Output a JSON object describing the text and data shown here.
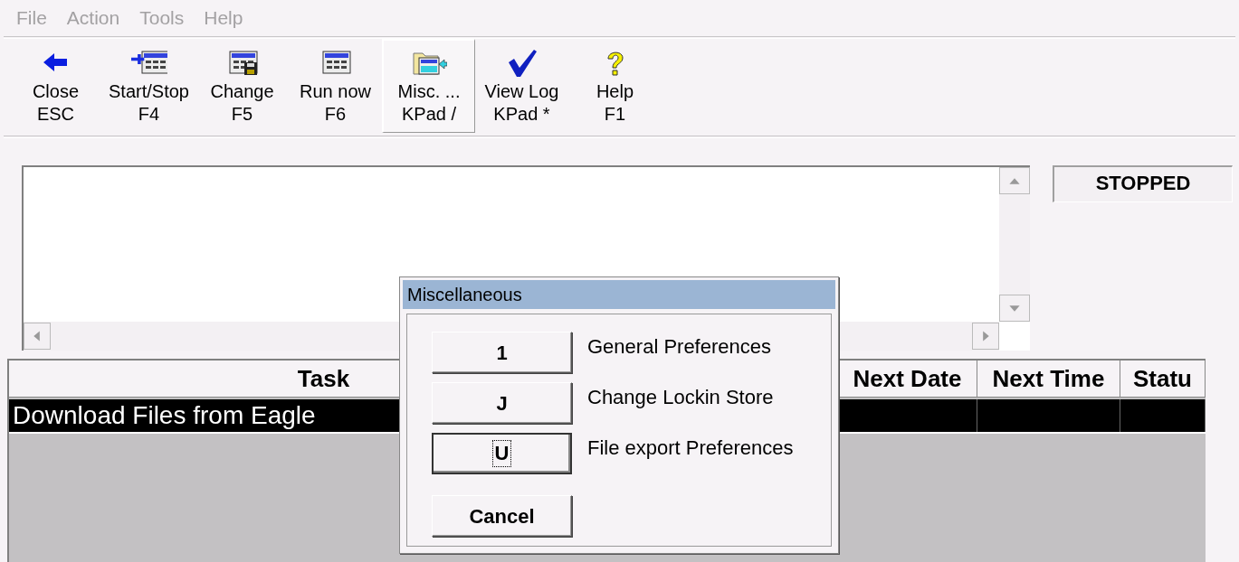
{
  "menu": [
    {
      "label": "File",
      "disabled": true
    },
    {
      "label": "Action",
      "disabled": true
    },
    {
      "label": "Tools",
      "disabled": true
    },
    {
      "label": "Help",
      "disabled": true
    }
  ],
  "toolbar": [
    {
      "kind": "close",
      "label": "Close",
      "key": "ESC",
      "pressed": false
    },
    {
      "kind": "startstop",
      "label": "Start/Stop",
      "key": "F4",
      "pressed": false
    },
    {
      "kind": "change",
      "label": "Change",
      "key": "F5",
      "pressed": false
    },
    {
      "kind": "run",
      "label": "Run now",
      "key": "F6",
      "pressed": false
    },
    {
      "kind": "misc",
      "label": "Misc. ...",
      "key": "KPad /",
      "pressed": true
    },
    {
      "kind": "log",
      "label": "View Log",
      "key": "KPad *",
      "pressed": false
    },
    {
      "kind": "help",
      "label": "Help",
      "key": "F1",
      "pressed": false
    }
  ],
  "status": "STOPPED",
  "table": {
    "columns": [
      "Task",
      "",
      "Next Date",
      "Next Time",
      "Statu"
    ],
    "rows": [
      {
        "selected": true,
        "cells": [
          "Download Files from Eagle",
          "",
          "",
          "",
          ""
        ]
      }
    ]
  },
  "dialog": {
    "title": "Miscellaneous",
    "options": [
      {
        "key": "1",
        "label": "General Preferences",
        "focused": false
      },
      {
        "key": "J",
        "label": "Change Lockin Store",
        "focused": false
      },
      {
        "key": "U",
        "label": "File export Preferences",
        "focused": true
      }
    ],
    "cancel": "Cancel"
  }
}
